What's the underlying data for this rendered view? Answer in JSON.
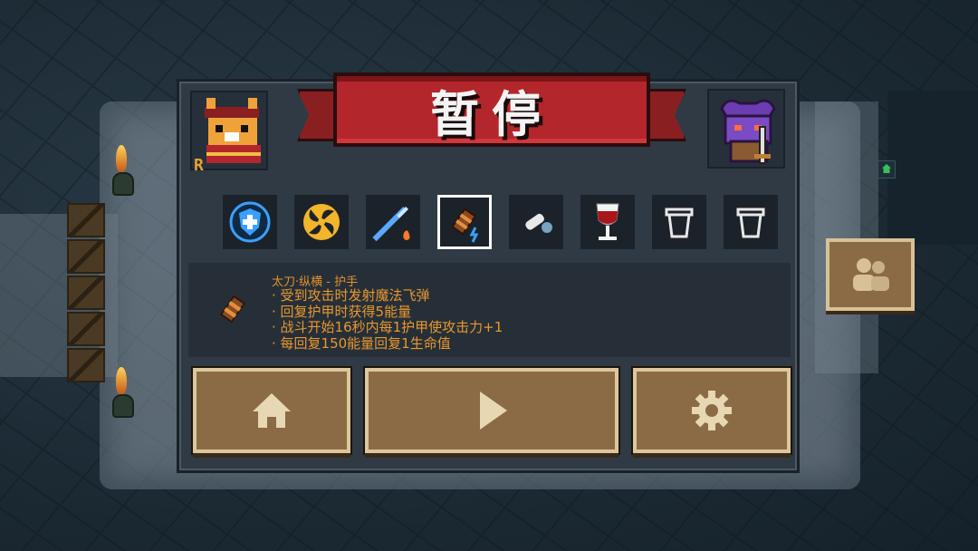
{
  "title": "暂停",
  "character_portrait": {
    "badge": "R"
  },
  "inventory": [
    {
      "icon": "shield-buff-icon",
      "selected": false
    },
    {
      "icon": "spiral-buff-icon",
      "selected": false
    },
    {
      "icon": "spear-weapon-icon",
      "selected": false
    },
    {
      "icon": "bracer-item-icon",
      "selected": true
    },
    {
      "icon": "bullet-item-icon",
      "selected": false
    },
    {
      "icon": "wine-glass-icon",
      "selected": false
    },
    {
      "icon": "empty-cup-icon",
      "selected": false
    },
    {
      "icon": "empty-cup-icon",
      "selected": false
    }
  ],
  "selected_item": {
    "name": "太刀·纵横 - 护手",
    "effects": [
      "受到攻击时发射魔法飞弹",
      "回复护甲时获得5能量",
      "战斗开始16秒内每1护甲使攻击力+1",
      "每回复150能量回复1生命值"
    ]
  },
  "buttons": {
    "home": "home-icon",
    "resume": "play-icon",
    "settings": "gear-icon"
  },
  "colors": {
    "banner": "#b3262b",
    "button": "#8b6b45",
    "text_accent": "#e8972f"
  }
}
